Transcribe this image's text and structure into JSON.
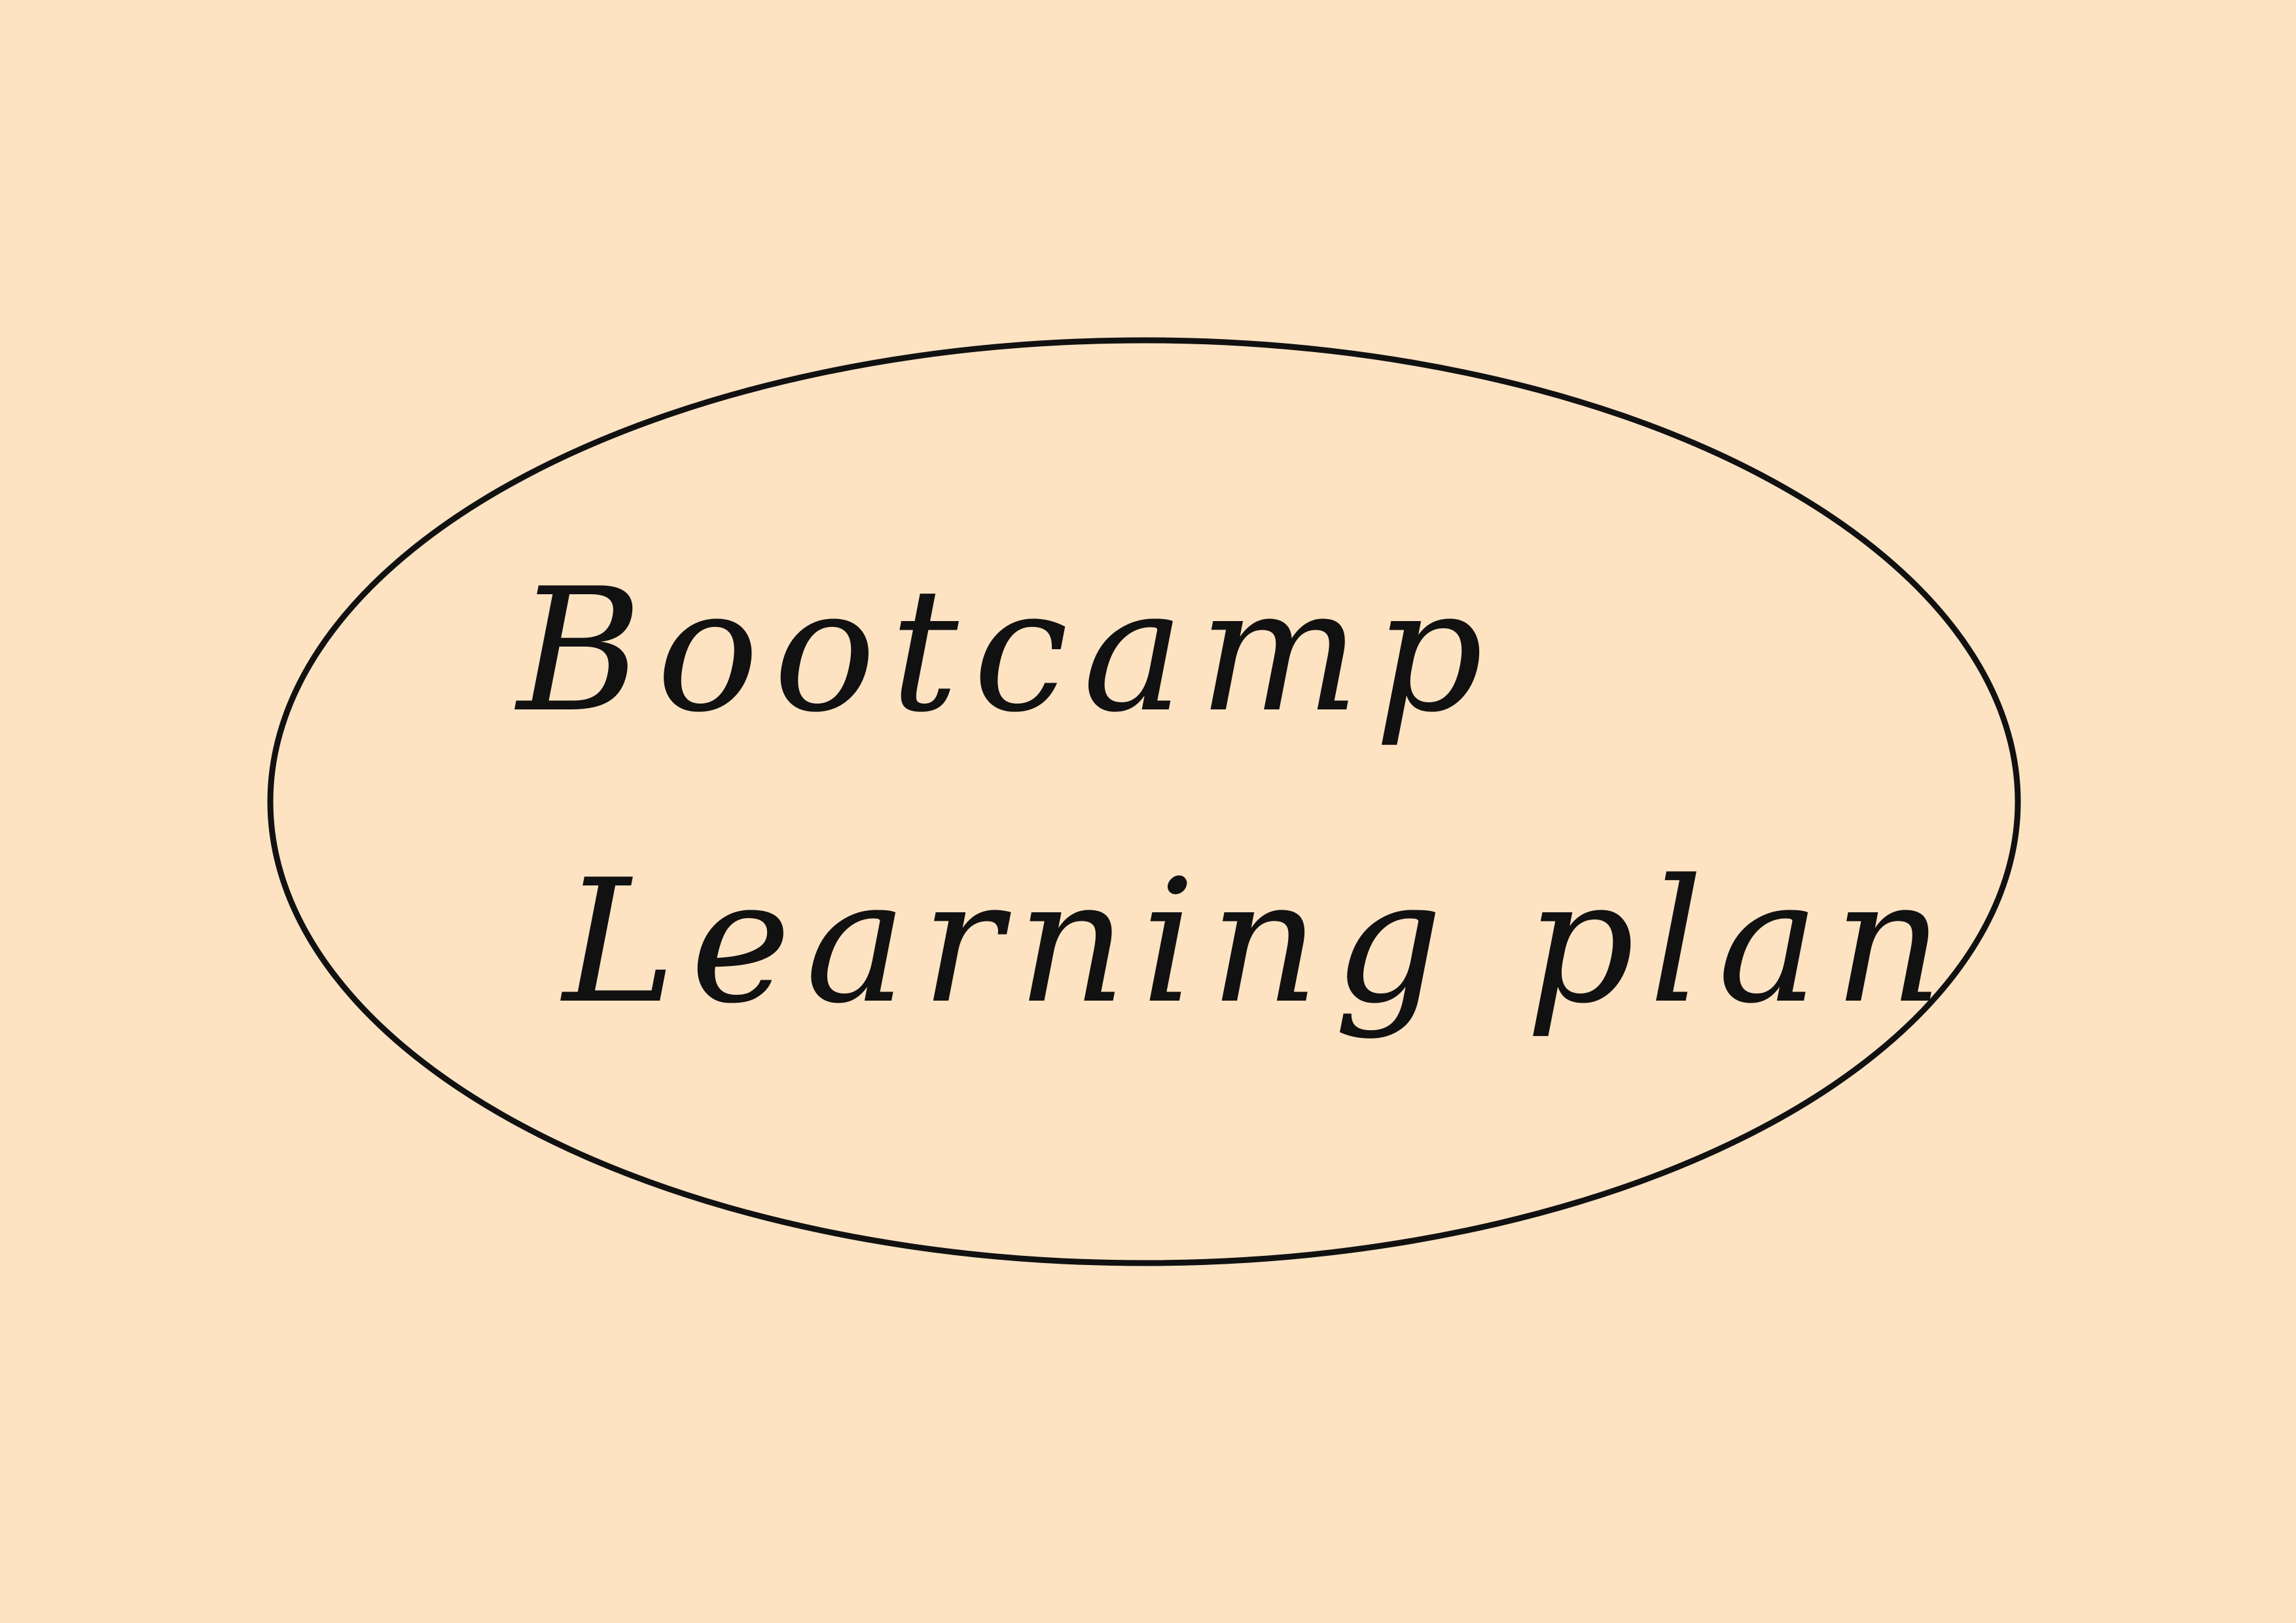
{
  "note": {
    "lines": [
      "Bootcamp",
      "Learning plan"
    ]
  },
  "colors": {
    "background": "#FEE3C3",
    "ink": "#111111"
  }
}
